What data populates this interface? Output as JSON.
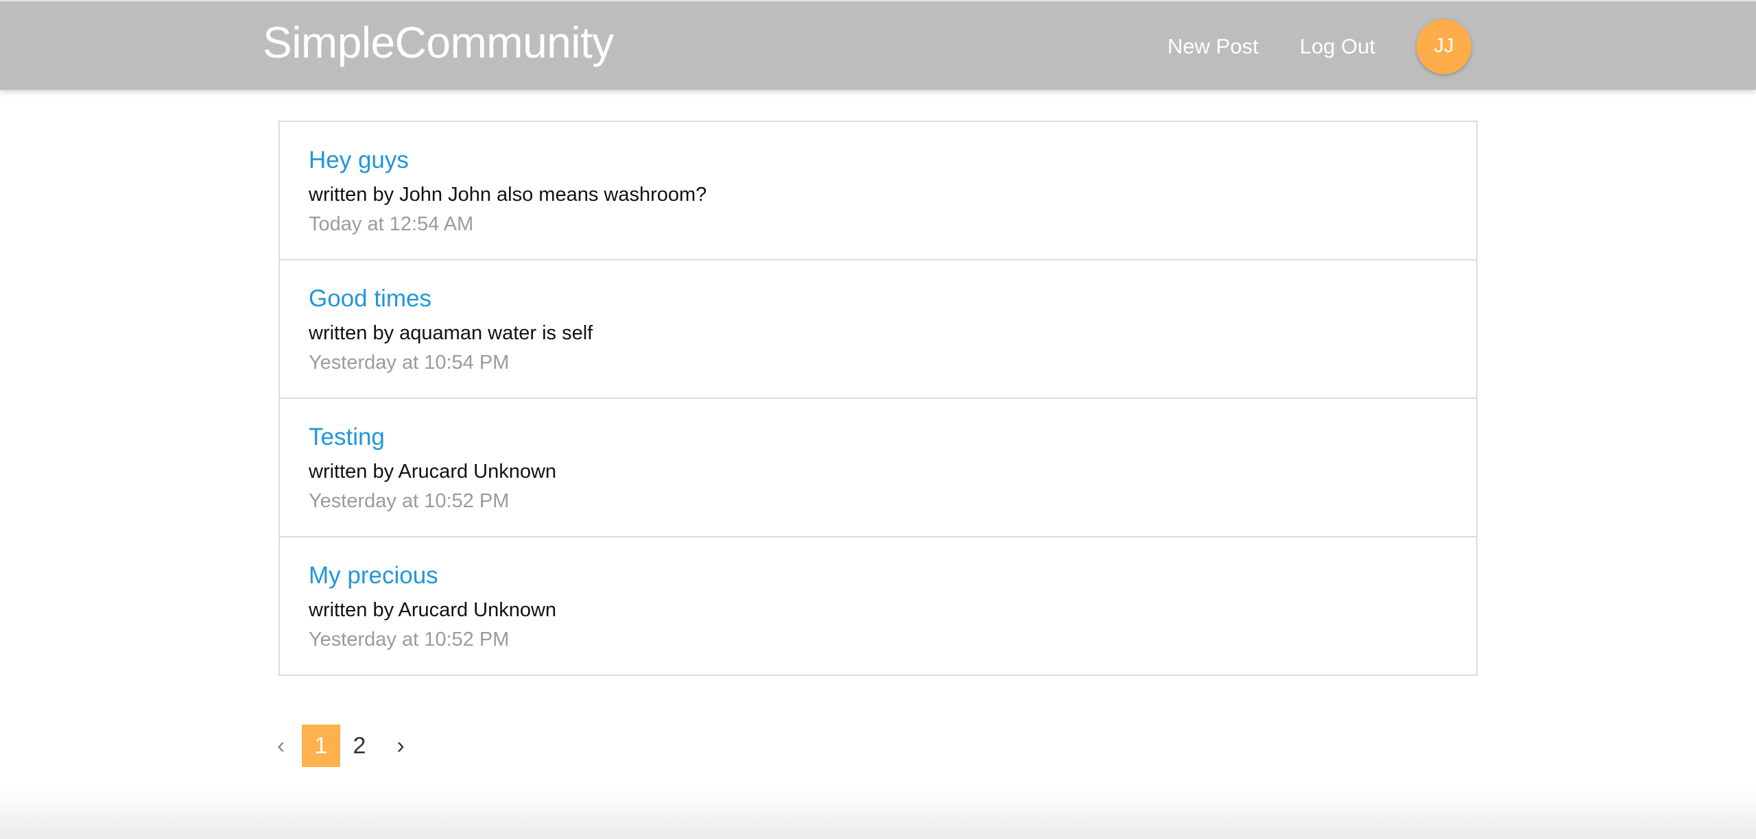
{
  "header": {
    "brand": "SimpleCommunity",
    "nav": {
      "new_post": "New Post",
      "log_out": "Log Out"
    },
    "avatar_initials": "JJ",
    "colors": {
      "navbar_bg": "#bdbdbd",
      "avatar_bg": "#ffac4b"
    }
  },
  "posts": [
    {
      "title": "Hey guys",
      "meta": "written by John John also means washroom?",
      "time": "Today at 12:54 AM"
    },
    {
      "title": "Good times",
      "meta": "written by aquaman water is self",
      "time": "Yesterday at 10:54 PM"
    },
    {
      "title": "Testing",
      "meta": "written by Arucard Unknown",
      "time": "Yesterday at 10:52 PM"
    },
    {
      "title": "My precious",
      "meta": "written by Arucard Unknown",
      "time": "Yesterday at 10:52 PM"
    }
  ],
  "pagination": {
    "prev": "‹",
    "pages": [
      "1",
      "2"
    ],
    "current_page": "1",
    "next": "›",
    "active_color": "#ffb14e"
  }
}
